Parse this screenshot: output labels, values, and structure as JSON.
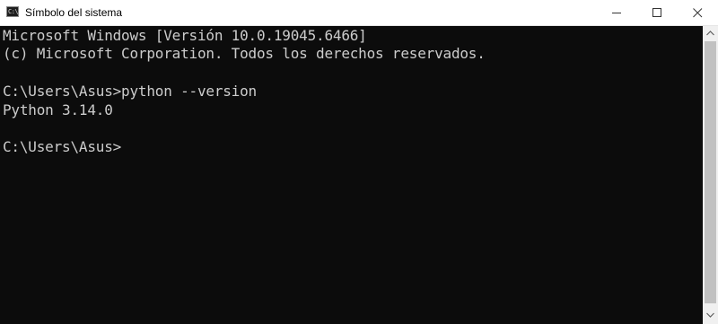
{
  "window": {
    "title": "Símbolo del sistema",
    "icon": "cmd-icon",
    "icon_glyph": "C:\\"
  },
  "controls": {
    "minimize": "minimize-icon",
    "maximize": "maximize-icon",
    "close": "close-icon"
  },
  "console": {
    "lines": [
      "Microsoft Windows [Versión 10.0.19045.6466]",
      "(c) Microsoft Corporation. Todos los derechos reservados.",
      "",
      "C:\\Users\\Asus>python --version",
      "Python 3.14.0",
      "",
      "C:\\Users\\Asus>"
    ]
  },
  "colors": {
    "console_background": "#0c0c0c",
    "console_text": "#cccccc",
    "titlebar": "#ffffff",
    "scrollbar_track": "#f0f0f0",
    "scrollbar_thumb": "#c1c1c1"
  }
}
